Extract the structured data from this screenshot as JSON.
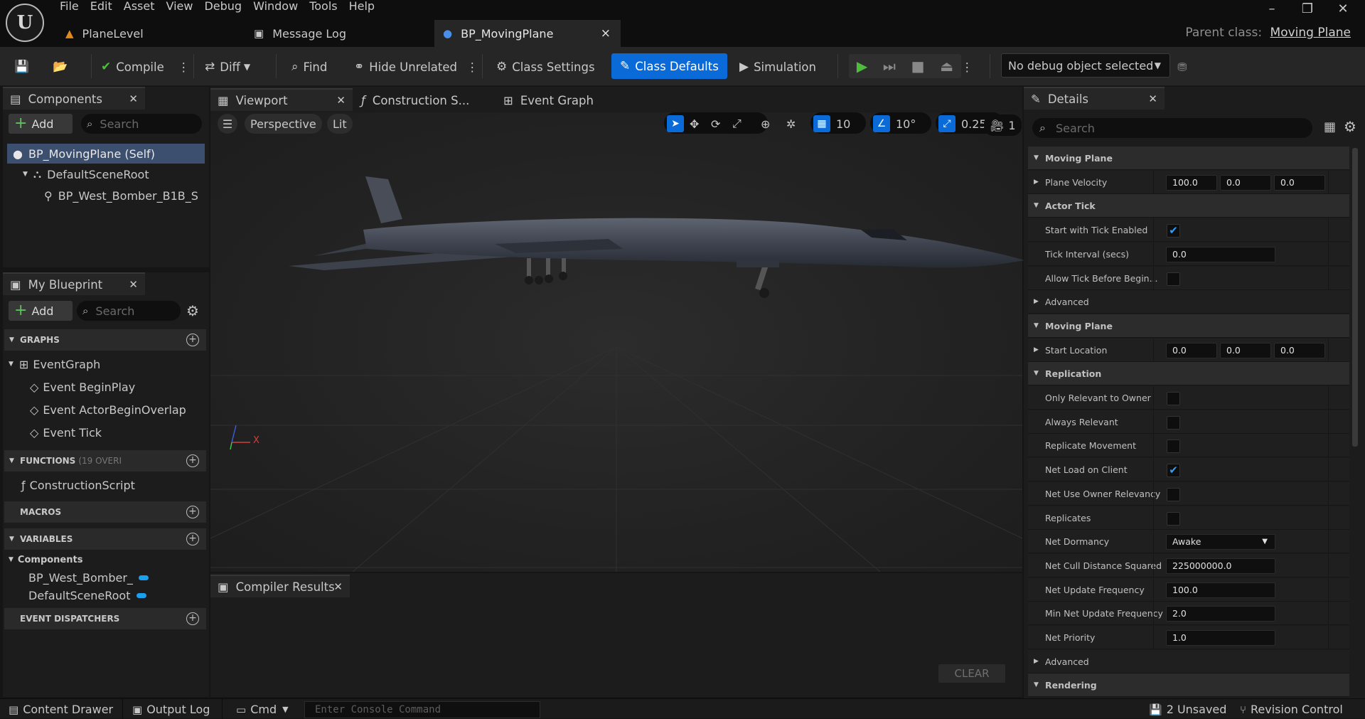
{
  "menu": [
    "File",
    "Edit",
    "Asset",
    "View",
    "Debug",
    "Window",
    "Tools",
    "Help"
  ],
  "window_controls": {
    "minimize": "–",
    "maximize": "❐",
    "close": "✕"
  },
  "doc_tabs": [
    {
      "label": "PlaneLevel"
    },
    {
      "label": "Message Log"
    },
    {
      "label": "BP_MovingPlane",
      "close": "×"
    }
  ],
  "parent_class": {
    "label": "Parent class:",
    "value": "Moving Plane"
  },
  "toolbar": {
    "compile": "Compile",
    "diff": "Diff",
    "find": "Find",
    "hide_unrelated": "Hide Unrelated",
    "class_settings": "Class Settings",
    "class_defaults": "Class Defaults",
    "simulation": "Simulation",
    "debug_object": "No debug object selected"
  },
  "components": {
    "tab": "Components",
    "add": "Add",
    "search_placeholder": "Search",
    "tree": [
      "BP_MovingPlane (Self)",
      "DefaultSceneRoot",
      "BP_West_Bomber_B1B_S"
    ]
  },
  "my_blueprint": {
    "tab": "My Blueprint",
    "add": "Add",
    "search_placeholder": "Search",
    "graphs": {
      "header": "GRAPHS",
      "items": [
        "EventGraph",
        "Event BeginPlay",
        "Event ActorBeginOverlap",
        "Event Tick"
      ]
    },
    "functions": {
      "header": "FUNCTIONS",
      "note": "(19 OVERI",
      "items": [
        "ConstructionScript"
      ]
    },
    "macros": {
      "header": "MACROS"
    },
    "variables": {
      "header": "VARIABLES",
      "group": "Components",
      "items": [
        "BP_West_Bomber_",
        "DefaultSceneRoot"
      ]
    },
    "dispatchers": {
      "header": "EVENT DISPATCHERS"
    }
  },
  "editor_tabs": [
    "Viewport",
    "Construction S...",
    "Event Graph"
  ],
  "viewport": {
    "perspective": "Perspective",
    "lit": "Lit",
    "grid_snap": "10",
    "rot_snap": "10°",
    "scale_snap": "0.25",
    "camera_speed": "1",
    "axis_x": "X"
  },
  "compiler": {
    "tab": "Compiler Results",
    "clear": "CLEAR"
  },
  "details": {
    "tab": "Details",
    "search_placeholder": "Search",
    "rows": [
      {
        "type": "cat",
        "label": "Moving Plane"
      },
      {
        "type": "vec",
        "label": "Plane Velocity",
        "values": [
          "100.0",
          "0.0",
          "0.0"
        ]
      },
      {
        "type": "cat",
        "label": "Actor Tick"
      },
      {
        "type": "check",
        "label": "Start with Tick Enabled",
        "checked": true
      },
      {
        "type": "num",
        "label": "Tick Interval (secs)",
        "value": "0.0"
      },
      {
        "type": "check",
        "label": "Allow Tick Before Begin...",
        "checked": false
      },
      {
        "type": "sub",
        "label": "Advanced"
      },
      {
        "type": "cat",
        "label": "Moving Plane"
      },
      {
        "type": "vec",
        "label": "Start Location",
        "values": [
          "0.0",
          "0.0",
          "0.0"
        ]
      },
      {
        "type": "cat",
        "label": "Replication"
      },
      {
        "type": "check",
        "label": "Only Relevant to Owner",
        "checked": false
      },
      {
        "type": "check",
        "label": "Always Relevant",
        "checked": false
      },
      {
        "type": "check",
        "label": "Replicate Movement",
        "checked": false
      },
      {
        "type": "check",
        "label": "Net Load on Client",
        "checked": true
      },
      {
        "type": "check",
        "label": "Net Use Owner Relevancy",
        "checked": false
      },
      {
        "type": "check",
        "label": "Replicates",
        "checked": false
      },
      {
        "type": "select",
        "label": "Net Dormancy",
        "value": "Awake"
      },
      {
        "type": "num",
        "label": "Net Cull Distance Squared",
        "value": "225000000.0"
      },
      {
        "type": "num",
        "label": "Net Update Frequency",
        "value": "100.0"
      },
      {
        "type": "num",
        "label": "Min Net Update Frequency",
        "value": "2.0"
      },
      {
        "type": "num",
        "label": "Net Priority",
        "value": "1.0"
      },
      {
        "type": "sub",
        "label": "Advanced"
      },
      {
        "type": "cat",
        "label": "Rendering"
      }
    ]
  },
  "statusbar": {
    "content_drawer": "Content Drawer",
    "output_log": "Output Log",
    "cmd": "Cmd",
    "console_placeholder": "Enter Console Command",
    "unsaved": "2 Unsaved",
    "revision": "Revision Control"
  },
  "colors": {
    "accent": "#0a6ad8",
    "bg": "#151515",
    "panel": "#1c1c1c",
    "play": "#4ebd3c"
  }
}
